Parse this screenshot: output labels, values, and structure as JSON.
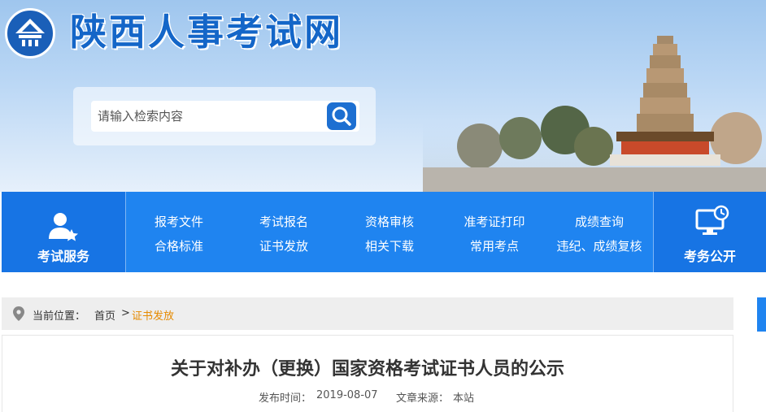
{
  "site": {
    "title": "陕西人事考试网"
  },
  "search": {
    "placeholder": "请输入检索内容"
  },
  "nav": {
    "left_caption": "考试服务",
    "right_caption": "考务公开",
    "links_row1": [
      "报考文件",
      "考试报名",
      "资格审核",
      "准考证打印",
      "成绩查询"
    ],
    "links_row2": [
      "合格标准",
      "证书发放",
      "相关下载",
      "常用考点",
      "违纪、成绩复核"
    ]
  },
  "breadcrumb": {
    "prefix": "当前位置：",
    "home": "首页",
    "separator": ">",
    "current": "证书发放"
  },
  "article": {
    "title": "关于对补办（更换）国家资格考试证书人员的公示",
    "published_label": "发布时间：",
    "published_date": "2019-08-07",
    "source_label": "文章来源：",
    "source": "本站"
  },
  "colors": {
    "brand_blue": "#1f84f0",
    "title_blue": "#1466c8",
    "breadcrumb_current": "#e58a00"
  }
}
